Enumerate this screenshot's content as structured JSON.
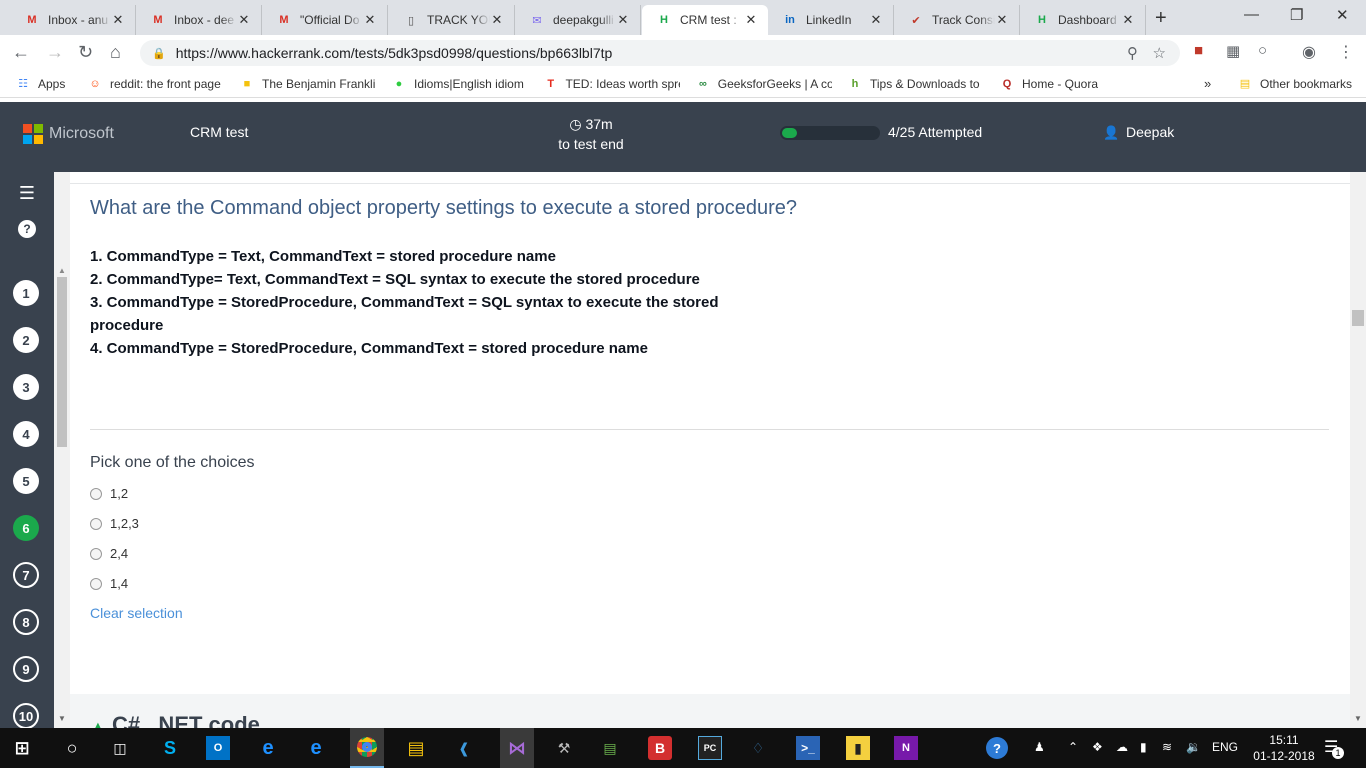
{
  "browser": {
    "tabs": [
      {
        "title": "Inbox - anu",
        "icon": "gmail-icon",
        "color": "#d93025"
      },
      {
        "title": "Inbox - dee",
        "icon": "gmail-icon",
        "color": "#d93025"
      },
      {
        "title": "\"Official Do",
        "icon": "gmail-icon",
        "color": "#d93025"
      },
      {
        "title": "TRACK YOU",
        "icon": "document-icon",
        "color": "#555555"
      },
      {
        "title": "deepakgulli",
        "icon": "mail-icon",
        "color": "#7b68ee"
      },
      {
        "title": "CRM test :",
        "icon": "hackerrank-icon",
        "color": "#1ba94c",
        "active": true
      },
      {
        "title": "LinkedIn",
        "icon": "linkedin-icon",
        "color": "#0a66c2"
      },
      {
        "title": "Track Consi",
        "icon": "checkmark-icon",
        "color": "#c0392b"
      },
      {
        "title": "Dashboard",
        "icon": "hackerrank-icon",
        "color": "#1ba94c"
      }
    ],
    "url": "https://www.hackerrank.com/tests/5dk3psd0998/questions/bp663lbl7tp",
    "bookmarks": [
      {
        "label": "Apps",
        "icon": "apps-grid-icon",
        "color": "#4285f4"
      },
      {
        "label": "reddit: the front page",
        "icon": "reddit-icon",
        "color": "#ff4500"
      },
      {
        "label": "The Benjamin Frankli",
        "icon": "bookmark-icon",
        "color": "#f4c20d"
      },
      {
        "label": "Idioms|English idiom",
        "icon": "globe-icon",
        "color": "#2ecc40"
      },
      {
        "label": "TED: Ideas worth spre",
        "icon": "ted-icon",
        "color": "#e62b1e"
      },
      {
        "label": "GeeksforGeeks | A co",
        "icon": "gfg-icon",
        "color": "#2f8d46"
      },
      {
        "label": "Tips & Downloads to",
        "icon": "tips-icon",
        "color": "#5aa02c"
      },
      {
        "label": "Home - Quora",
        "icon": "quora-icon",
        "color": "#b92b27"
      }
    ],
    "bookmarks_more": "»",
    "other_bookmarks": "Other bookmarks"
  },
  "header": {
    "brand": "Microsoft",
    "test_name": "CRM test",
    "timer_value": "37m",
    "timer_caption": "to test end",
    "progress_fraction": 0.16,
    "attempted": "4/25 Attempted",
    "user": "Deepak"
  },
  "sidebar": {
    "questions": [
      {
        "n": "1",
        "state": "done"
      },
      {
        "n": "2",
        "state": "done"
      },
      {
        "n": "3",
        "state": "done"
      },
      {
        "n": "4",
        "state": "done"
      },
      {
        "n": "5",
        "state": "done"
      },
      {
        "n": "6",
        "state": "current"
      },
      {
        "n": "7",
        "state": "todo"
      },
      {
        "n": "8",
        "state": "todo"
      },
      {
        "n": "9",
        "state": "todo"
      },
      {
        "n": "10",
        "state": "todo"
      }
    ]
  },
  "question": {
    "title": "What are the Command object property settings to execute a stored procedure?",
    "lines": [
      "1. CommandType = Text, CommandText = stored procedure name",
      "2. CommandType= Text, CommandText = SQL syntax to execute the stored procedure",
      "3. CommandType = StoredProcedure, CommandText = SQL syntax to execute the stored procedure",
      "4. CommandType = StoredProcedure, CommandText = stored procedure name"
    ],
    "pick_label": "Pick one of the choices",
    "choices": [
      "1,2",
      "1,2,3",
      "2,4",
      "1,4"
    ],
    "clear_label": "Clear selection",
    "next_section": "C#, .NET code"
  },
  "taskbar": {
    "lang": "ENG",
    "time": "15:11",
    "date": "01-12-2018",
    "notifications": "1"
  }
}
